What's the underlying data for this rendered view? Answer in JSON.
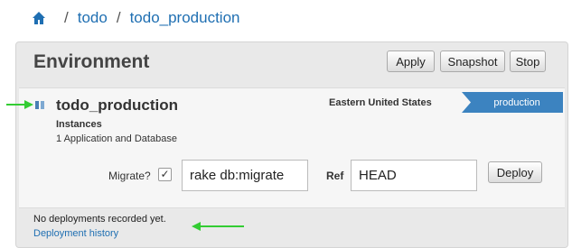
{
  "breadcrumb": {
    "items": [
      "todo",
      "todo_production"
    ],
    "separator": "/"
  },
  "panel": {
    "title": "Environment",
    "buttons": {
      "apply": "Apply",
      "snapshot": "Snapshot",
      "stop": "Stop"
    }
  },
  "environment": {
    "name": "todo_production",
    "region": "Eastern United States",
    "tag": "production",
    "instances_label": "Instances",
    "instances_value": "1 Application and Database"
  },
  "deploy": {
    "migrate_label": "Migrate?",
    "migrate_checked": "✓",
    "migrate_command": "rake db:migrate",
    "ref_label": "Ref",
    "ref_value": "HEAD",
    "deploy_button": "Deploy"
  },
  "footer": {
    "no_deployments": "No deployments recorded yet.",
    "history_link": "Deployment history"
  },
  "colors": {
    "accent": "#3c83c0",
    "link": "#1f6fb2",
    "annotation_arrow": "#33cc33"
  }
}
